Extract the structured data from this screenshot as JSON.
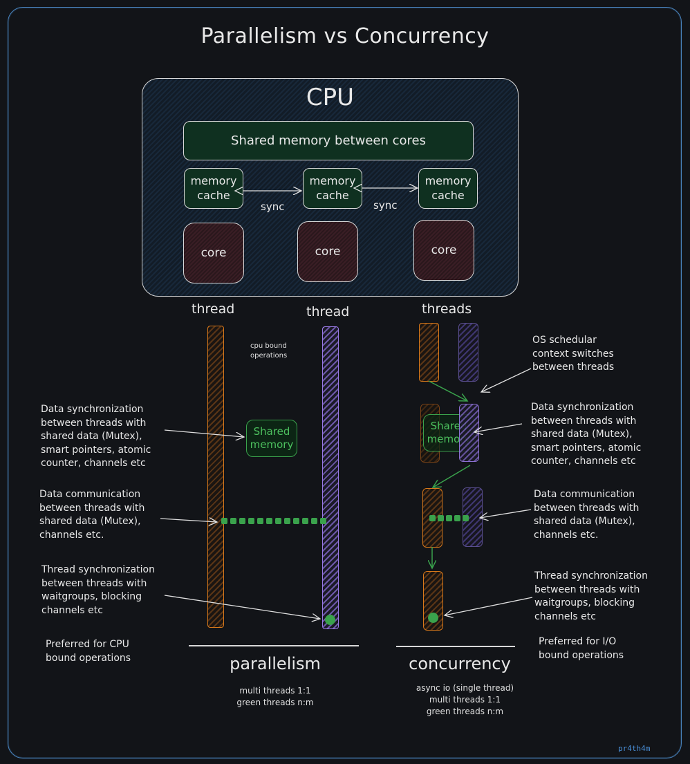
{
  "title": "Parallelism vs Concurrency",
  "cpu": {
    "label": "CPU",
    "shared_memory": "Shared memory between cores",
    "caches": [
      "memory\ncache",
      "memory\ncache",
      "memory\ncache"
    ],
    "sync_labels": [
      "sync",
      "sync"
    ],
    "cores": [
      "core",
      "core",
      "core"
    ]
  },
  "parallelism": {
    "thread_labels": [
      "thread",
      "thread"
    ],
    "cpu_bound_note": "cpu bound\noperations",
    "shared_memory": "Shared\nmemory",
    "notes": {
      "data_sync": "Data synchronization\nbetween threads with\nshared data (Mutex),\nsmart pointers, atomic\ncounter, channels etc",
      "data_comm": "Data communication\nbetween threads with\nshared data (Mutex),\nchannels etc.",
      "thread_sync": "Thread synchronization\nbetween threads with\nwaitgroups, blocking\nchannels etc",
      "preferred": "Preferred for CPU\nbound operations"
    },
    "heading": "parallelism",
    "models": "multi threads 1:1\ngreen threads n:m"
  },
  "concurrency": {
    "thread_label": "threads",
    "shared_memory": "Shared\nmemory",
    "notes": {
      "scheduler": "OS schedular\ncontext switches\nbetween threads",
      "data_sync": "Data synchronization\nbetween threads with\nshared data (Mutex),\nsmart pointers, atomic\ncounter, channels etc",
      "data_comm": "Data communication\nbetween threads with\nshared data (Mutex),\nchannels etc.",
      "thread_sync": "Thread synchronization\nbetween threads with\nwaitgroups, blocking\nchannels etc",
      "preferred": "Preferred for I/O\nbound operations"
    },
    "heading": "concurrency",
    "models": "async io (single thread)\nmulti threads 1:1\ngreen threads n:m"
  },
  "credit": "pr4th4m",
  "colors": {
    "background": "#121418",
    "frame": "#4a86c2",
    "thread_a": "#d9791a",
    "thread_b": "#9a7ae6",
    "sync_green": "#3aa24c",
    "cache_fill": "#0f3020",
    "core_fill": "#3a1e25"
  }
}
